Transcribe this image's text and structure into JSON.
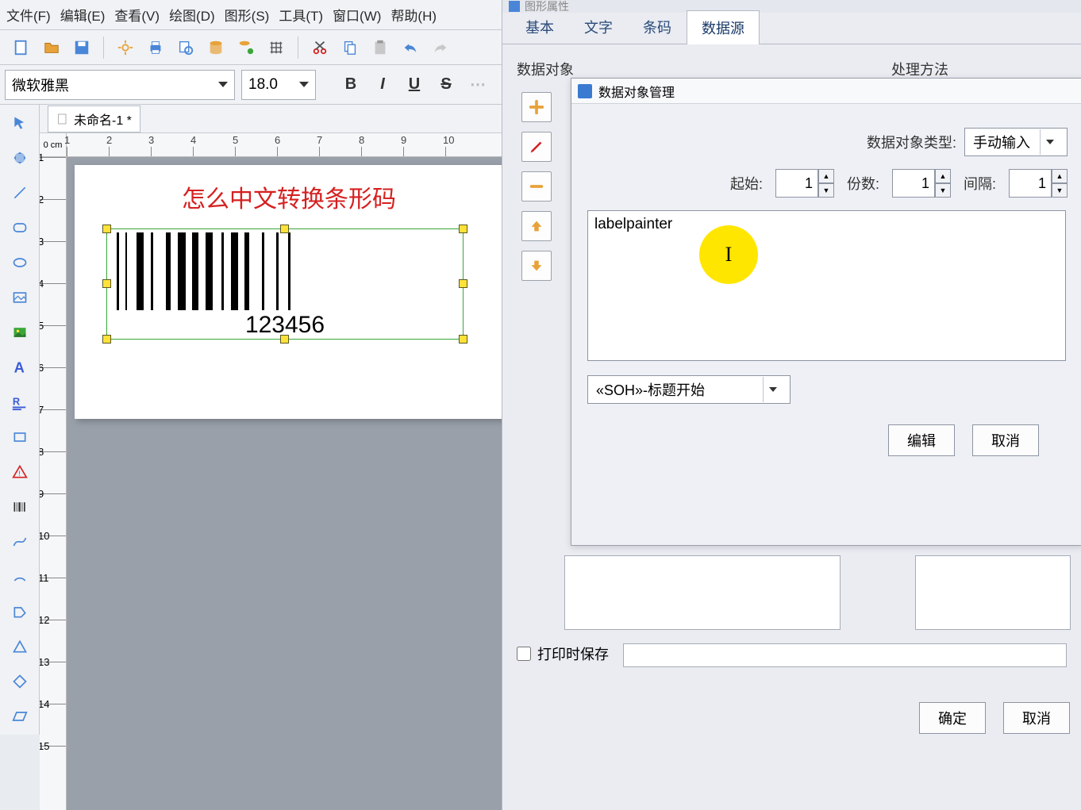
{
  "menubar": {
    "file": "文件(F)",
    "edit": "编辑(E)",
    "view": "查看(V)",
    "draw": "绘图(D)",
    "shape": "图形(S)",
    "tools": "工具(T)",
    "window": "窗口(W)",
    "help": "帮助(H)"
  },
  "formatbar": {
    "font": "微软雅黑",
    "size": "18.0",
    "bold": "B",
    "italic": "I",
    "underline": "U",
    "strike": "S"
  },
  "document": {
    "tab_title": "未命名-1 *"
  },
  "ruler": {
    "unit": "0 cm",
    "h_ticks": [
      "1",
      "2",
      "3",
      "4",
      "5",
      "6",
      "7",
      "8",
      "9",
      "10"
    ],
    "v_ticks": [
      "1",
      "2",
      "3",
      "4",
      "5",
      "6",
      "7",
      "8",
      "9",
      "10",
      "11",
      "12",
      "13",
      "14",
      "15"
    ]
  },
  "canvas": {
    "title_text": "怎么中文转换条形码",
    "barcode_value": "123456"
  },
  "rightpanel": {
    "win_title": "图形属性",
    "tabs": {
      "basic": "基本",
      "text": "文字",
      "barcode": "条码",
      "datasource": "数据源"
    },
    "group_data_object": "数据对象",
    "group_process": "处理方法"
  },
  "dialog": {
    "title": "数据对象管理",
    "type_label": "数据对象类型:",
    "type_value": "手动输入",
    "start_label": "起始:",
    "start_value": "1",
    "count_label": "份数:",
    "count_value": "1",
    "gap_label": "间隔:",
    "gap_value": "1",
    "text_value": "labelpainter",
    "soh_combo": "«SOH»-标题开始",
    "edit_btn": "编辑",
    "cancel_btn": "取消"
  },
  "lower": {
    "print_save": "打印时保存",
    "ok": "确定",
    "cancel": "取消"
  }
}
